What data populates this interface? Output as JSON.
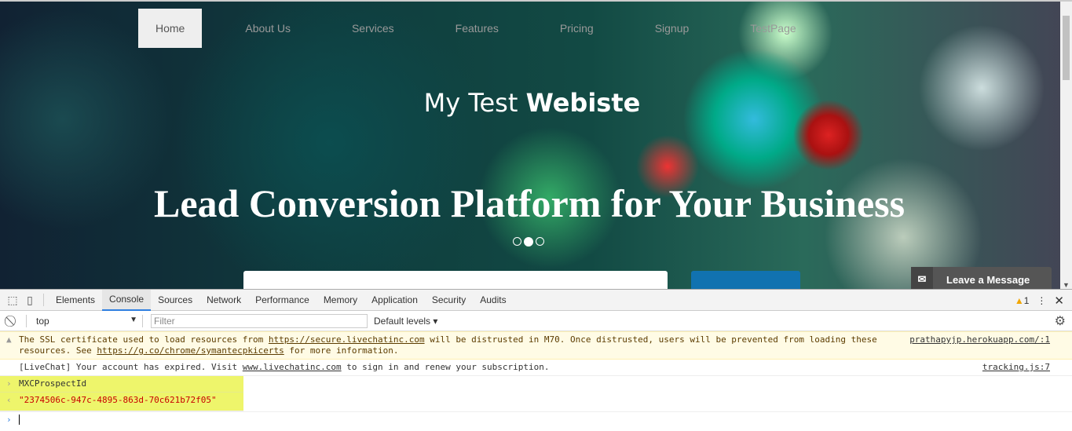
{
  "site": {
    "nav": [
      "Home",
      "About Us",
      "Services",
      "Features",
      "Pricing",
      "Signup",
      "TestPage"
    ],
    "title_regular": "My Test ",
    "title_bold": "Webiste",
    "hero": "Lead Conversion Platform for Your Business",
    "carousel": {
      "slides": 3,
      "active": 2
    },
    "chat_label": "Leave a Message"
  },
  "devtools": {
    "tabs": [
      "Elements",
      "Console",
      "Sources",
      "Network",
      "Performance",
      "Memory",
      "Application",
      "Security",
      "Audits"
    ],
    "active_tab": "Console",
    "warning_count": "1",
    "context": "top",
    "filter_placeholder": "Filter",
    "levels": "Default levels",
    "messages": [
      {
        "type": "warning",
        "parts": [
          "The SSL certificate used to load resources from ",
          "https://secure.livechatinc.com",
          " will be distrusted in M70. Once distrusted, users will be prevented from loading these resources. See ",
          "https://g.co/chrome/symantecpkicerts",
          " for more information."
        ],
        "source": "prathapyjp.herokuapp.com/:1"
      },
      {
        "type": "log",
        "parts": [
          "[LiveChat] Your account has expired. Visit ",
          "www.livechatinc.com",
          " to sign in and renew your subscription."
        ],
        "source": "tracking.js:7"
      }
    ],
    "input": "MXCProspectId",
    "result": "\"2374506c-947c-4895-863d-70c621b72f05\""
  },
  "colors": {
    "accent": "#2f7fe0",
    "warning": "#f2a600",
    "result": "#c80000",
    "highlight": "#eef56b",
    "chat_button": "#1172b0"
  }
}
